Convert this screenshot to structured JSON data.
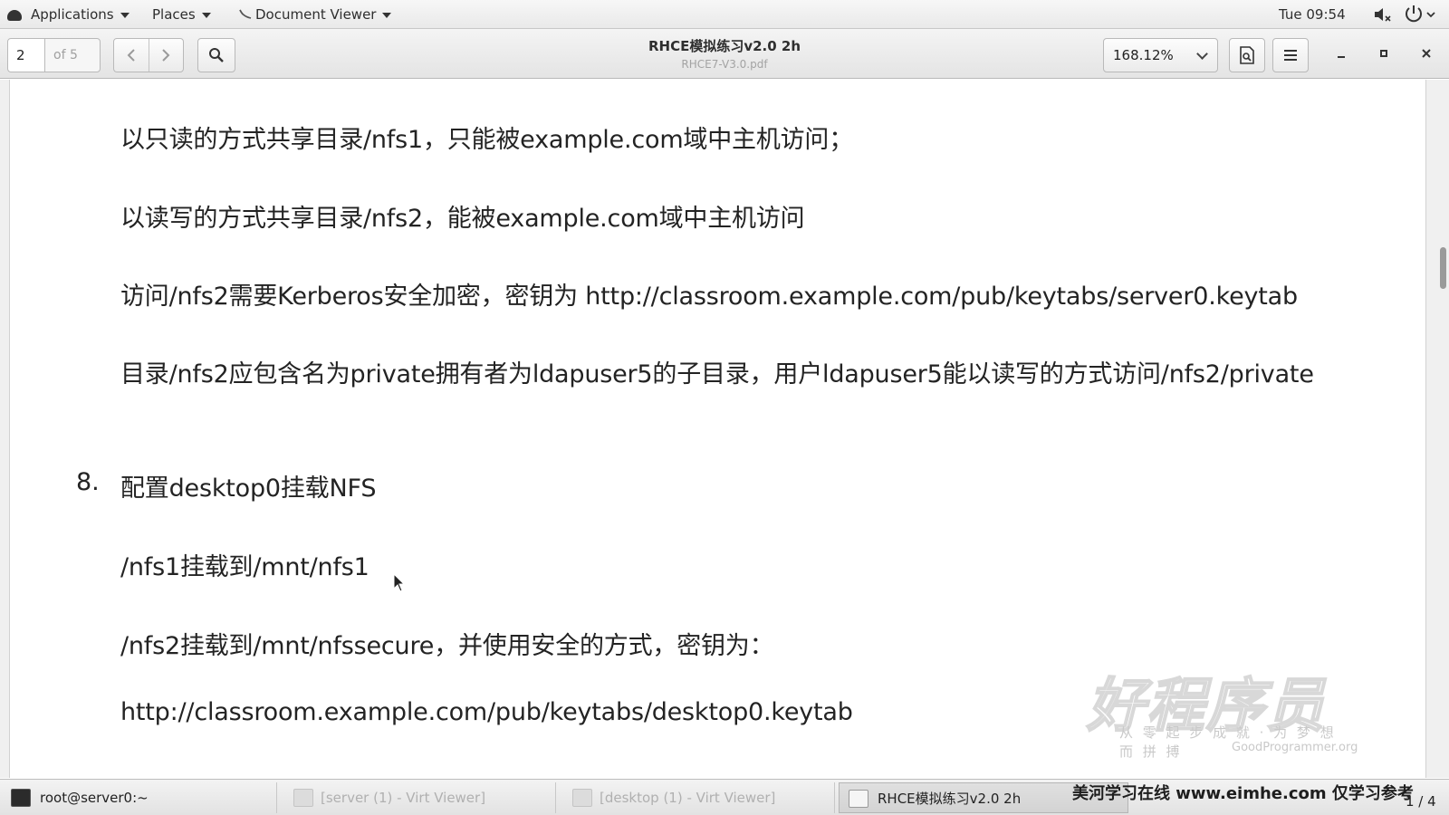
{
  "topbar": {
    "applications": "Applications",
    "places": "Places",
    "app_name": "Document Viewer",
    "clock": "Tue 09:54"
  },
  "header": {
    "page_current": "2",
    "page_total": "of 5",
    "title": "RHCE模拟练习v2.0 2h",
    "subtitle": "RHCE7-V3.0.pdf",
    "zoom": "168.12%"
  },
  "document": {
    "lines": [
      "以只读的方式共享目录/nfs1，只能被example.com域中主机访问；",
      "以读写的方式共享目录/nfs2，能被example.com域中主机访问",
      "访问/nfs2需要Kerberos安全加密，密钥为  http://classroom.example.com/pub/keytabs/server0.keytab",
      "目录/nfs2应包含名为private拥有者为ldapuser5的子目录，用户ldapuser5能以读写的方式访问/nfs2/private"
    ],
    "section_number": "8.",
    "section_title": "配置desktop0挂载NFS",
    "section_lines": [
      "/nfs1挂载到/mnt/nfs1",
      "/nfs2挂载到/mnt/nfssecure，并使用安全的方式，密钥为：",
      "http://classroom.example.com/pub/keytabs/desktop0.keytab"
    ]
  },
  "watermark": {
    "logo": "好程序员",
    "tagline": "从 零 起 步 成 就 · 为 梦 想 而 拼 搏",
    "url": "GoodProgrammer.org"
  },
  "taskbar": {
    "items": [
      {
        "label": "root@server0:~",
        "icon": "terminal-icon"
      },
      {
        "label": "[server (1) - Virt Viewer]",
        "icon": "virt-viewer-icon"
      },
      {
        "label": "[desktop (1) - Virt Viewer]",
        "icon": "virt-viewer-icon"
      },
      {
        "label": "RHCE模拟练习v2.0 2h",
        "icon": "document-viewer-icon"
      }
    ],
    "overlay": "美河学习在线 www.eimhe.com 仅学习参考",
    "pager": "1 / 4"
  }
}
